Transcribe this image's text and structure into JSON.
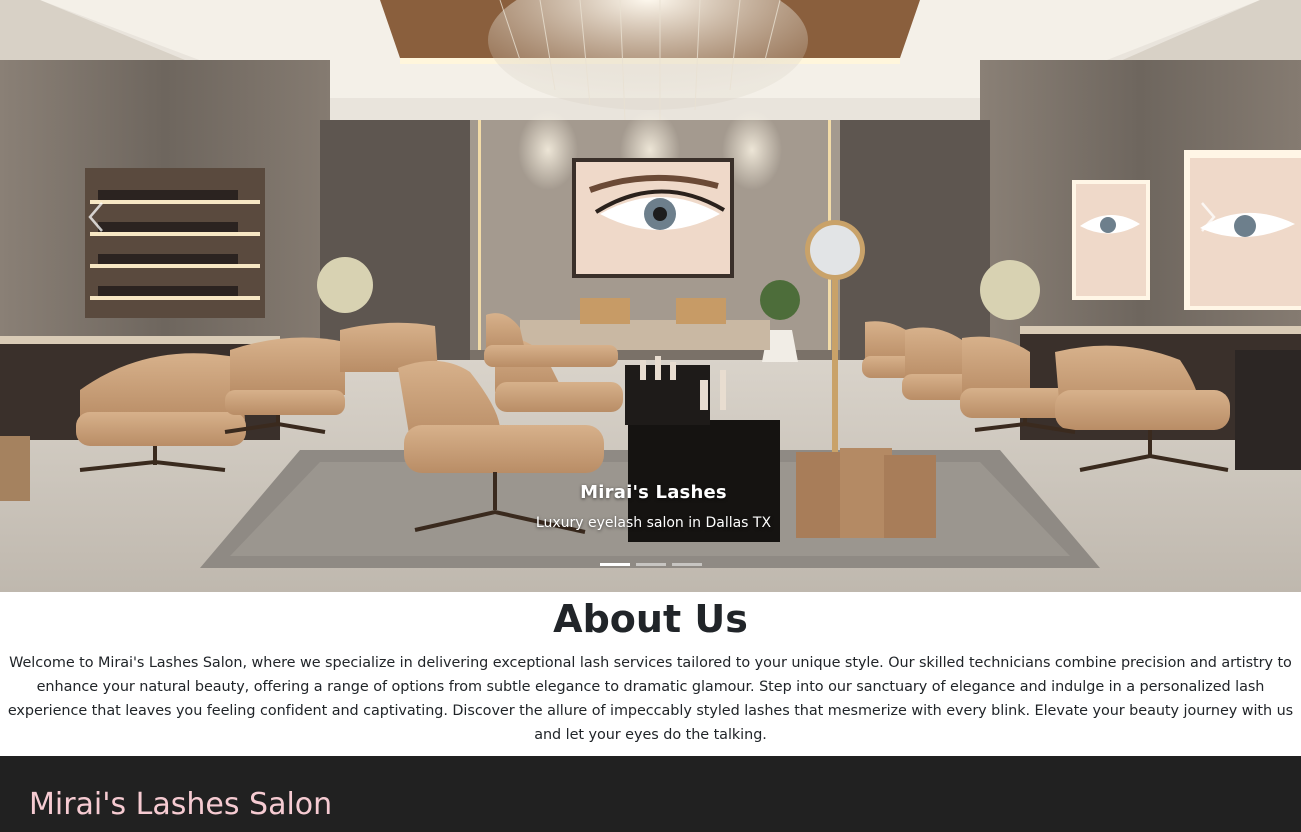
{
  "carousel": {
    "caption_title": "Mirai's Lashes",
    "caption_subtitle": "Luxury eyelash salon in Dallas TX",
    "prev_icon": "chevron-left-icon",
    "next_icon": "chevron-right-icon",
    "slide_count": 3,
    "active_slide": 1
  },
  "about": {
    "heading": "About Us",
    "body": "Welcome to Mirai's Lashes Salon, where we specialize in delivering exceptional lash services tailored to your unique style. Our skilled technicians combine precision and artistry to enhance your natural beauty, offering a range of options from subtle elegance to dramatic glamour. Step into our sanctuary of elegance and indulge in a personalized lash experience that leaves you feeling confident and captivating. Discover the allure of impeccably styled lashes that mesmerize with every blink. Elevate your beauty journey with us and let your eyes do the talking."
  },
  "footer": {
    "brand": "Mirai's Lashes Salon"
  },
  "colors": {
    "footer_bg": "#212121",
    "brand_pink": "#f6cbd2",
    "text_dark": "#212529"
  }
}
